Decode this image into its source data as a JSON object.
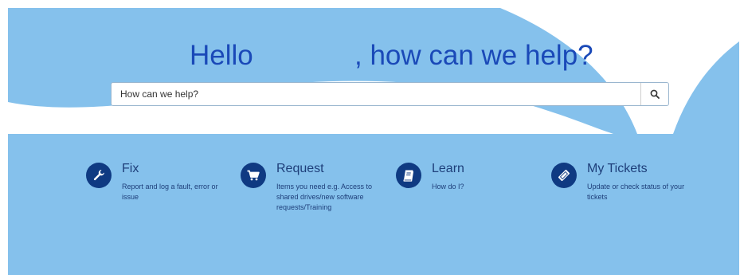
{
  "header": {
    "greeting": "Hello",
    "question": ", how can we help?"
  },
  "search": {
    "placeholder": "How can we help?",
    "button_icon": "search-icon"
  },
  "cards": [
    {
      "title": "Fix",
      "description": "Report and log a fault, error or issue",
      "icon": "wrench-icon"
    },
    {
      "title": "Request",
      "description": "Items you need e.g. Access to shared drives/new software requests/Training",
      "icon": "shopping-cart-icon"
    },
    {
      "title": "Learn",
      "description": "How do I?",
      "icon": "book-icon"
    },
    {
      "title": "My Tickets",
      "description": "Update or check status of your tickets",
      "icon": "ticket-icon"
    }
  ],
  "colors": {
    "background": "#85c1ec",
    "title": "#1a49b8",
    "icon_circle": "#0f3a82",
    "card_text": "#1e3f7a"
  }
}
